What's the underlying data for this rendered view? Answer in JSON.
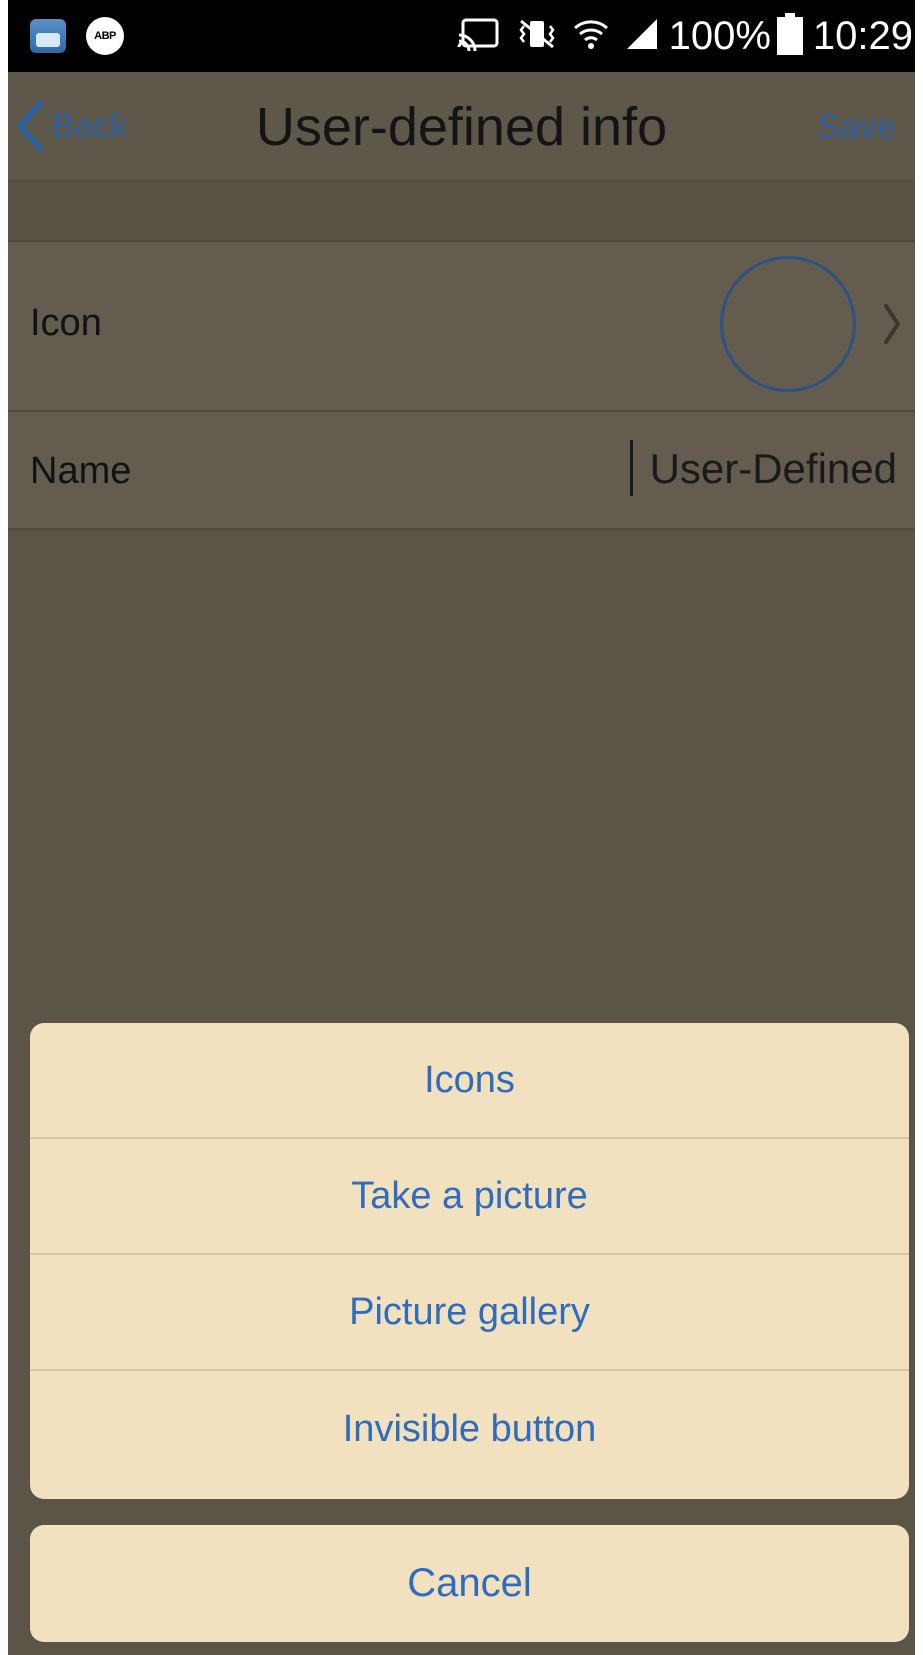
{
  "status_bar": {
    "battery_percent": "100%",
    "time": "10:29",
    "left_icons": [
      "files-app-icon",
      "adblock-plus-icon"
    ],
    "right_icons": [
      "cast-icon",
      "vibrate-icon",
      "wifi-icon",
      "signal-icon",
      "battery-icon"
    ],
    "abp_label": "ABP"
  },
  "nav": {
    "back_label": "Back",
    "title": "User-defined info",
    "save_label": "Save"
  },
  "rows": {
    "icon_label": "Icon",
    "name_label": "Name",
    "name_value": "User-Defined"
  },
  "action_sheet": {
    "items": [
      {
        "label": "Icons"
      },
      {
        "label": "Take a picture"
      },
      {
        "label": "Picture gallery"
      },
      {
        "label": "Invisible button"
      }
    ],
    "cancel_label": "Cancel"
  },
  "colors": {
    "accent": "#2f6bbf",
    "sheet_bg": "#f2e1bf",
    "overlay": "#5b5548"
  }
}
